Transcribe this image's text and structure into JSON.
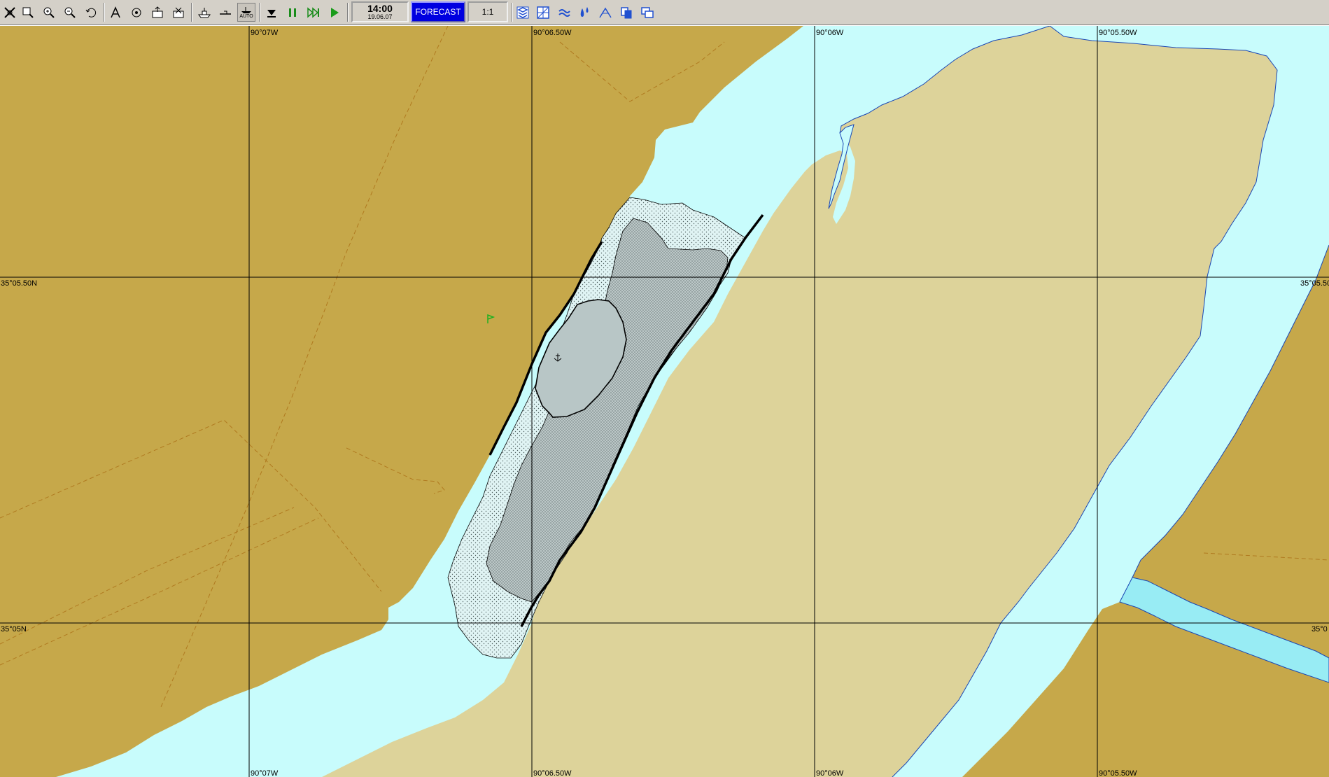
{
  "toolbar": {
    "buttons": [
      {
        "name": "pan-icon"
      },
      {
        "name": "zoom-window-icon"
      },
      {
        "name": "zoom-in-icon"
      },
      {
        "name": "zoom-out-icon"
      },
      {
        "name": "undo-icon"
      },
      {
        "name": "measure-icon"
      },
      {
        "name": "target-icon"
      },
      {
        "name": "route-export-icon"
      },
      {
        "name": "route-import-icon"
      },
      {
        "name": "ship-icon"
      },
      {
        "name": "ship-outline-icon"
      },
      {
        "name": "auto-mode-icon",
        "label": "AUTO"
      },
      {
        "name": "step-down-icon"
      },
      {
        "name": "pause-icon"
      },
      {
        "name": "fast-forward-icon"
      },
      {
        "name": "play-icon"
      },
      {
        "name": "layers-icon"
      },
      {
        "name": "grid-icon"
      },
      {
        "name": "current-icon"
      },
      {
        "name": "water-level-icon"
      },
      {
        "name": "wind-icon"
      },
      {
        "name": "copy-icon"
      },
      {
        "name": "windows-icon"
      }
    ],
    "auto_label": "AUTO",
    "time": "14:00",
    "date": "19.06.07",
    "forecast_label": "FORECAST",
    "scale": "1:1"
  },
  "map": {
    "longitude_labels_top": [
      "90°07W",
      "90°06.50W",
      "90°06W",
      "90°05.50W"
    ],
    "longitude_labels_bottom": [
      "90°07W",
      "90°06.50W",
      "90°06W",
      "90°05.50W"
    ],
    "latitude_labels_left": [
      "35°05.50N",
      "35°05N"
    ],
    "latitude_labels_right": [
      "35°05.50",
      "35°0"
    ],
    "colors": {
      "land_dark": "#c6a84a",
      "land_light": "#ddd39a",
      "water": "#c8fcfc",
      "channel": "#98ecf4",
      "flooded_area": "#d6e4e4",
      "flooded_inner": "#b8c6c6",
      "gridline": "#000000",
      "boundary": "#b07a20"
    }
  }
}
